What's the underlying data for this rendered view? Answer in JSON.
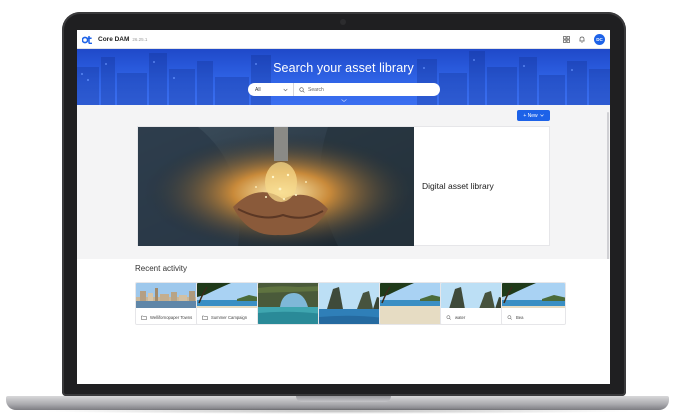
{
  "app": {
    "name": "Core DAM",
    "version": "26.25.1"
  },
  "user": {
    "initials": "DC"
  },
  "header_icons": [
    "grid-icon",
    "bell-icon"
  ],
  "hero": {
    "title": "Search your asset library",
    "scope_value": "All",
    "search_placeholder": "Search"
  },
  "toolbar": {
    "new_label": "+ New"
  },
  "feature": {
    "title": "Digital asset library"
  },
  "recent": {
    "title": "Recent activity",
    "items": [
      {
        "type": "collection",
        "label": "Wellifornopaper Towns",
        "icon": "folder-icon",
        "scene": "city"
      },
      {
        "type": "collection",
        "label": "Summer Campaign",
        "icon": "folder-icon",
        "scene": "beach-tree"
      },
      {
        "type": "asset",
        "label": "",
        "icon": "",
        "scene": "arch"
      },
      {
        "type": "asset",
        "label": "",
        "icon": "",
        "scene": "rocks"
      },
      {
        "type": "asset",
        "label": "",
        "icon": "",
        "scene": "beach-tree"
      },
      {
        "type": "search",
        "label": "water",
        "icon": "search-icon",
        "scene": "rocks"
      },
      {
        "type": "search",
        "label": "Bea",
        "icon": "search-icon",
        "scene": "beach-tree"
      }
    ]
  },
  "colors": {
    "brand": "#1d62e8",
    "hero": "#2f63e6",
    "frame": "#1f1f21"
  }
}
